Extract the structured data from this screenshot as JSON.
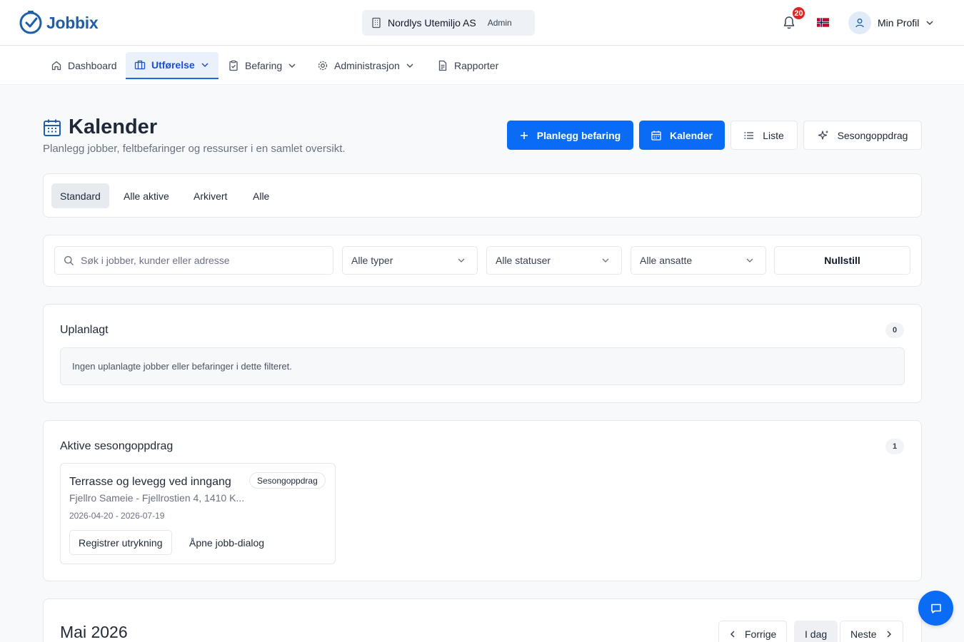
{
  "app": {
    "name": "Jobbix"
  },
  "org": {
    "name": "Nordlys Utemiljo AS",
    "role": "Admin"
  },
  "notifications": {
    "count": "20"
  },
  "profile": {
    "label": "Min Profil"
  },
  "nav": [
    {
      "label": "Dashboard",
      "icon": "home-icon"
    },
    {
      "label": "Utførelse",
      "icon": "briefcase-icon",
      "active": true
    },
    {
      "label": "Befaring",
      "icon": "clipboard-icon"
    },
    {
      "label": "Administrasjon",
      "icon": "gear-icon"
    },
    {
      "label": "Rapporter",
      "icon": "document-icon"
    }
  ],
  "page": {
    "title": "Kalender",
    "subtitle": "Planlegg jobber, feltbefaringer og ressurser i en samlet oversikt."
  },
  "actions": {
    "plan": "Planlegg befaring",
    "calendar": "Kalender",
    "list": "Liste",
    "season": "Sesongoppdrag"
  },
  "tabs": [
    "Standard",
    "Alle aktive",
    "Arkivert",
    "Alle"
  ],
  "filters": {
    "search_placeholder": "Søk i jobber, kunder eller adresse",
    "types": "Alle typer",
    "statuses": "Alle statuser",
    "employees": "Alle ansatte",
    "reset": "Nullstill"
  },
  "unplanned": {
    "title": "Uplanlagt",
    "count": "0",
    "empty": "Ingen uplanlagte jobber eller befaringer i dette filteret."
  },
  "seasonal": {
    "title": "Aktive sesongoppdrag",
    "count": "1",
    "jobs": [
      {
        "title": "Terrasse og levegg ved inngang",
        "tag": "Sesongoppdrag",
        "subtitle": "Fjellro Sameie - Fjellrostien 4, 1410 K...",
        "dates": "2026-04-20 - 2026-07-19",
        "register": "Registrer utrykning",
        "open": "Åpne jobb-dialog"
      }
    ]
  },
  "calendar": {
    "month": "Mai 2026",
    "prev": "Forrige",
    "today": "I dag",
    "next": "Neste"
  },
  "colors": {
    "primary": "#0a6cf5",
    "brand": "#1d5fa8",
    "badge": "#dc2626"
  }
}
